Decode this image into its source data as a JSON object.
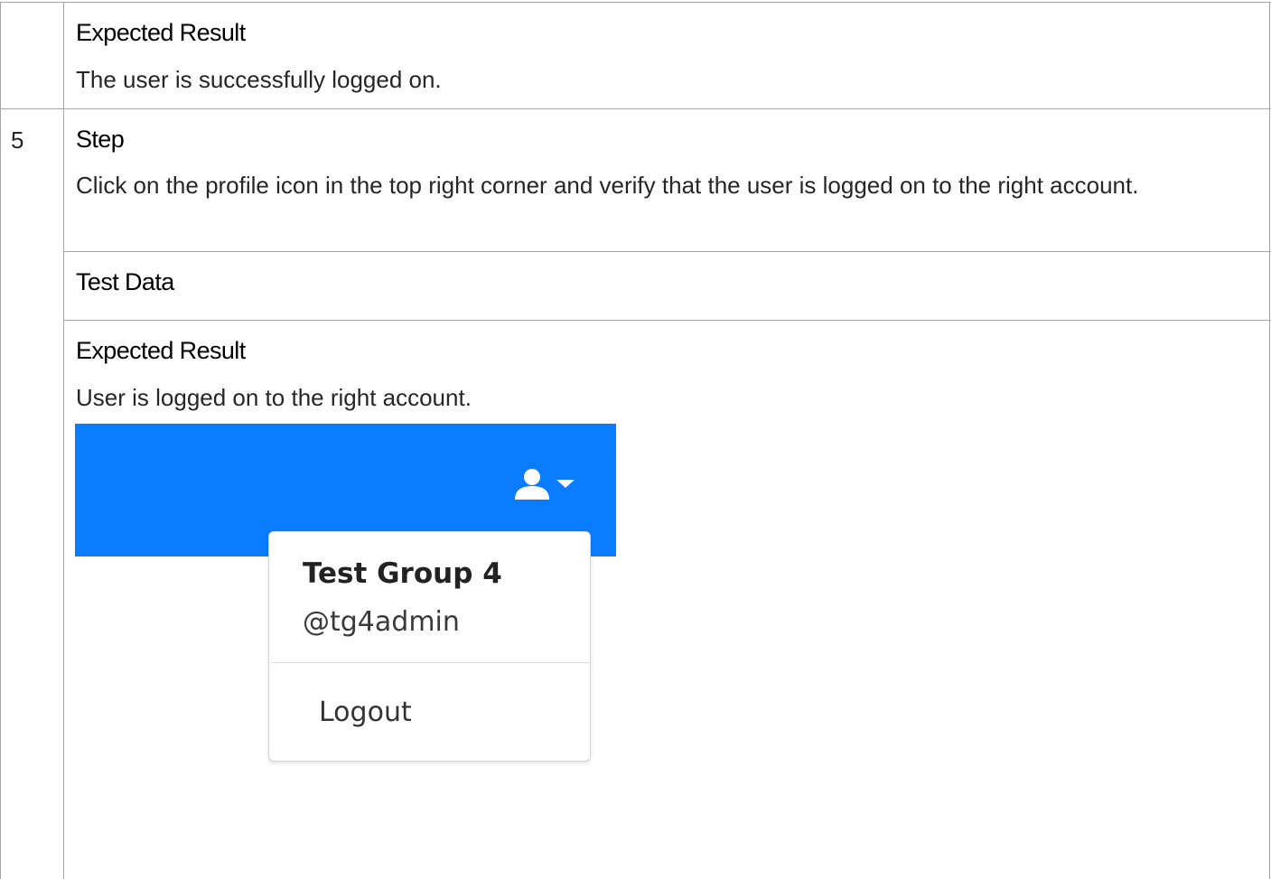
{
  "row_prev": {
    "expected_heading": "Expected Result",
    "expected_text": "The user is successfully logged on."
  },
  "row_step5": {
    "number": "5",
    "step_heading": "Step",
    "step_text": "Click on the profile icon in the top right corner and verify that the user is logged on to the right account.",
    "test_data_heading": "Test Data",
    "expected_heading": "Expected Result",
    "expected_text": "User is logged on to the right account."
  },
  "screenshot": {
    "navbar_color": "#0a7cff",
    "profile_icon": "user-icon",
    "caret_icon": "caret-down-icon",
    "menu": {
      "name": "Test Group 4",
      "handle": "@tg4admin",
      "logout_label": "Logout"
    }
  }
}
